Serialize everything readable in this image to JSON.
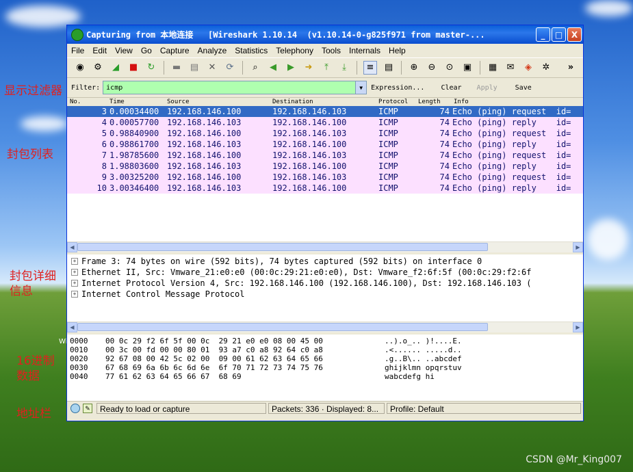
{
  "window": {
    "title": "Capturing from 本地连接   [Wireshark 1.10.14  (v1.10.14-0-g825f971 from master-...",
    "buttons": {
      "minimize": "_",
      "maximize": "□",
      "close": "X"
    }
  },
  "menubar": [
    "File",
    "Edit",
    "View",
    "Go",
    "Capture",
    "Analyze",
    "Statistics",
    "Telephony",
    "Tools",
    "Internals",
    "Help"
  ],
  "toolbar": {
    "overflow": "»"
  },
  "filter": {
    "label": "Filter:",
    "value": "icmp",
    "expression": "Expression...",
    "clear": "Clear",
    "apply": "Apply",
    "save": "Save"
  },
  "packet_list": {
    "columns": {
      "no": "No.",
      "time": "Time",
      "source": "Source",
      "destination": "Destination",
      "protocol": "Protocol",
      "length": "Length",
      "info": "Info"
    },
    "rows": [
      {
        "no": "3",
        "time": "0.00034400",
        "src": "192.168.146.100",
        "dst": "192.168.146.103",
        "proto": "ICMP",
        "len": "74",
        "info": "Echo (ping) request  id="
      },
      {
        "no": "4",
        "time": "0.00057700",
        "src": "192.168.146.103",
        "dst": "192.168.146.100",
        "proto": "ICMP",
        "len": "74",
        "info": "Echo (ping) reply    id="
      },
      {
        "no": "5",
        "time": "0.98840900",
        "src": "192.168.146.100",
        "dst": "192.168.146.103",
        "proto": "ICMP",
        "len": "74",
        "info": "Echo (ping) request  id="
      },
      {
        "no": "6",
        "time": "0.98861700",
        "src": "192.168.146.103",
        "dst": "192.168.146.100",
        "proto": "ICMP",
        "len": "74",
        "info": "Echo (ping) reply    id="
      },
      {
        "no": "7",
        "time": "1.98785600",
        "src": "192.168.146.100",
        "dst": "192.168.146.103",
        "proto": "ICMP",
        "len": "74",
        "info": "Echo (ping) request  id="
      },
      {
        "no": "8",
        "time": "1.98803600",
        "src": "192.168.146.103",
        "dst": "192.168.146.100",
        "proto": "ICMP",
        "len": "74",
        "info": "Echo (ping) reply    id="
      },
      {
        "no": "9",
        "time": "3.00325200",
        "src": "192.168.146.100",
        "dst": "192.168.146.103",
        "proto": "ICMP",
        "len": "74",
        "info": "Echo (ping) request  id="
      },
      {
        "no": "10",
        "time": "3.00346400",
        "src": "192.168.146.103",
        "dst": "192.168.146.100",
        "proto": "ICMP",
        "len": "74",
        "info": "Echo (ping) reply    id="
      }
    ]
  },
  "details": [
    "Frame 3: 74 bytes on wire (592 bits), 74 bytes captured (592 bits) on interface 0",
    "Ethernet II, Src: Vmware_21:e0:e0 (00:0c:29:21:e0:e0), Dst: Vmware_f2:6f:5f (00:0c:29:f2:6f",
    "Internet Protocol Version 4, Src: 192.168.146.100 (192.168.146.100), Dst: 192.168.146.103 (",
    "Internet Control Message Protocol"
  ],
  "hexdump": [
    {
      "offset": "0000",
      "hex": "00 0c 29 f2 6f 5f 00 0c  29 21 e0 e0 08 00 45 00",
      "ascii": "..).o_.. )!....E."
    },
    {
      "offset": "0010",
      "hex": "00 3c 00 fd 00 00 80 01  93 a7 c0 a8 92 64 c0 a8",
      "ascii": ".<...... .....d.."
    },
    {
      "offset": "0020",
      "hex": "92 67 08 00 42 5c 02 00  09 00 61 62 63 64 65 66",
      "ascii": ".g..B\\.. ..abcdef"
    },
    {
      "offset": "0030",
      "hex": "67 68 69 6a 6b 6c 6d 6e  6f 70 71 72 73 74 75 76",
      "ascii": "ghijklmn opqrstuv"
    },
    {
      "offset": "0040",
      "hex": "77 61 62 63 64 65 66 67  68 69",
      "ascii": "wabcdefg hi"
    }
  ],
  "statusbar": {
    "ready": "Ready to load or capture",
    "packets": "Packets: 336 · Displayed: 8...",
    "profile": "Profile: Default"
  },
  "annotations": [
    "显示过滤器",
    "封包列表",
    "封包详细\n信息",
    "16进制\n数据",
    "地址栏"
  ],
  "watermark": "CSDN @Mr_King007",
  "desktop_fragment": "Wi",
  "icons": [
    "wireshark-fin-icon",
    "interfaces-icon",
    "options-icon",
    "start-icon",
    "stop-icon",
    "restart-icon",
    "open-icon",
    "save-icon",
    "close-file-icon",
    "reload-icon",
    "find-icon",
    "back-icon",
    "forward-icon",
    "go-to-icon",
    "first-icon",
    "last-icon",
    "colorize-icon",
    "autoscroll-icon",
    "zoom-in-icon",
    "zoom-out-icon",
    "normal-size-icon",
    "resize-columns-icon",
    "capture-filters-icon",
    "display-filters-icon",
    "coloring-rules-icon",
    "preferences-icon"
  ]
}
